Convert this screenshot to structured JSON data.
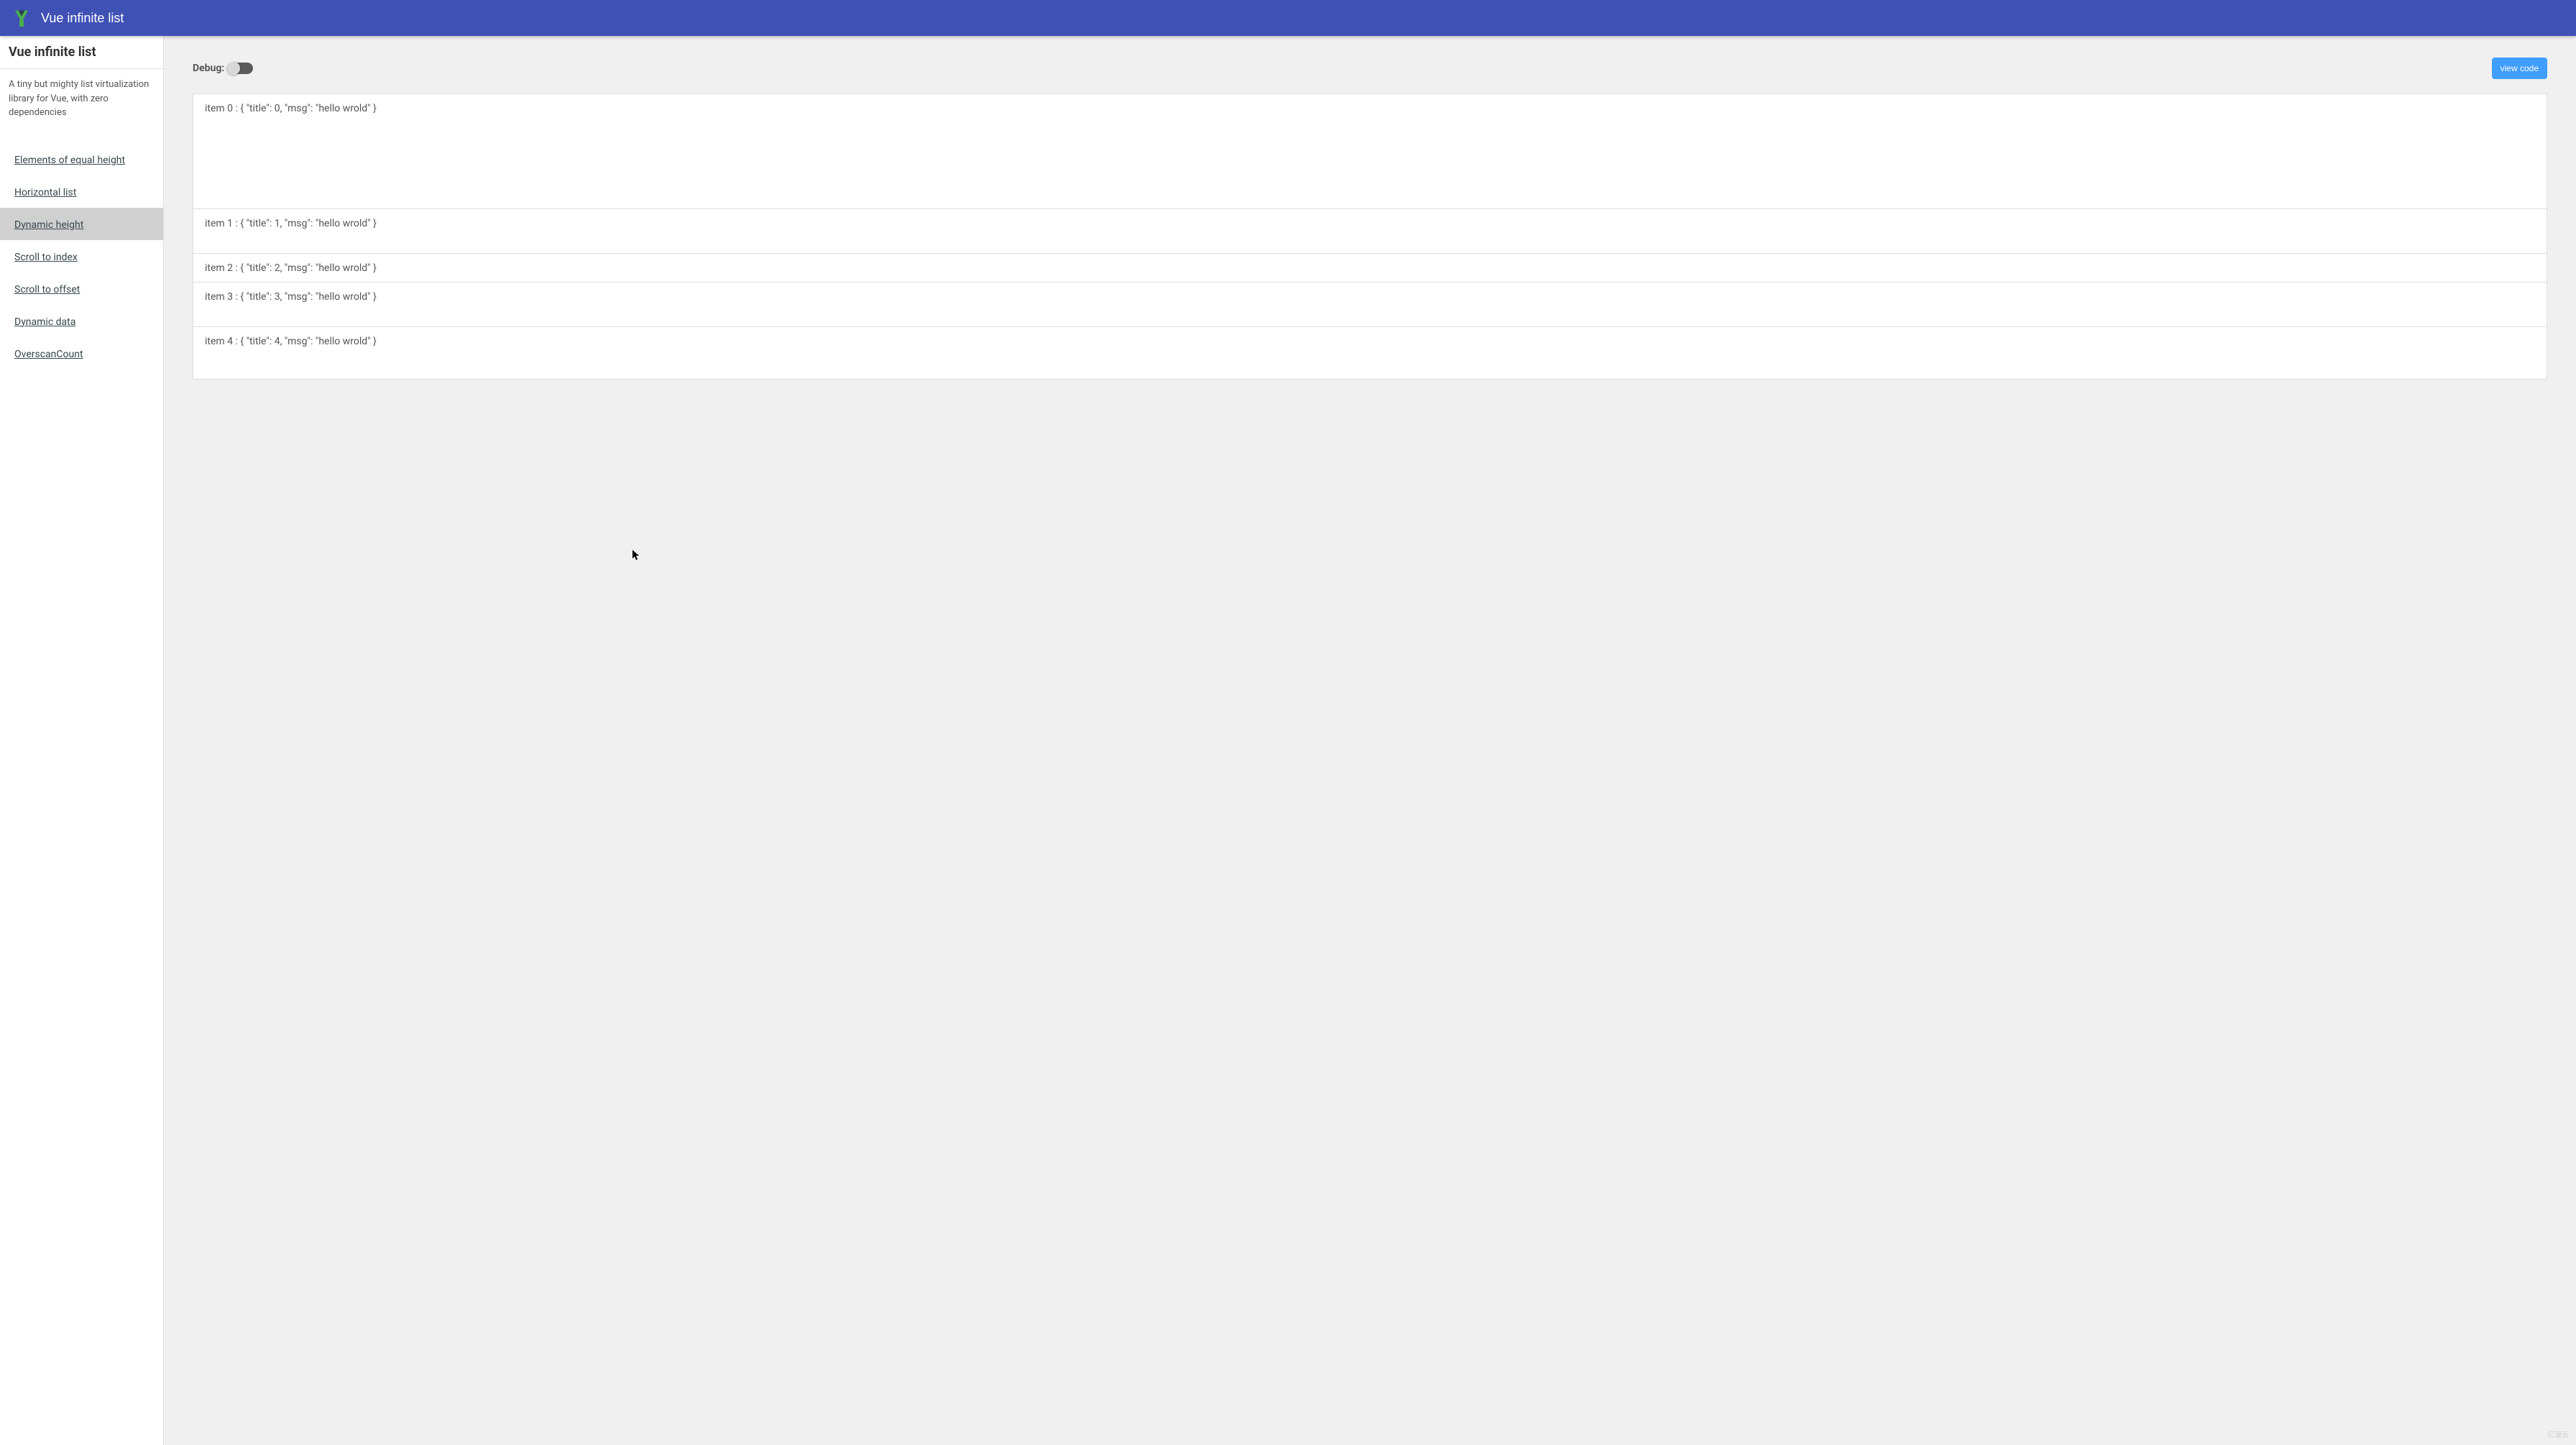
{
  "header": {
    "title": "Vue infinite list"
  },
  "sidebar": {
    "title": "Vue infinite list",
    "description": "A tiny but mighty list virtualization library for Vue, with zero dependencies",
    "items": [
      {
        "label": "Elements of equal height",
        "active": false
      },
      {
        "label": "Horizontal list",
        "active": false
      },
      {
        "label": "Dynamic height",
        "active": true
      },
      {
        "label": "Scroll to index",
        "active": false
      },
      {
        "label": "Scroll to offset",
        "active": false
      },
      {
        "label": "Dynamic data",
        "active": false
      },
      {
        "label": "OverscanCount",
        "active": false
      }
    ]
  },
  "main": {
    "debug_label": "Debug:",
    "view_code_label": "view code",
    "list_items": [
      "item 0 : { \"title\": 0, \"msg\": \"hello wrold\" }",
      "item 1 : { \"title\": 1, \"msg\": \"hello wrold\" }",
      "item 2 : { \"title\": 2, \"msg\": \"hello wrold\" }",
      "item 3 : { \"title\": 3, \"msg\": \"hello wrold\" }",
      "item 4 : { \"title\": 4, \"msg\": \"hello wrold\" }"
    ]
  },
  "watermark": "亿速云"
}
